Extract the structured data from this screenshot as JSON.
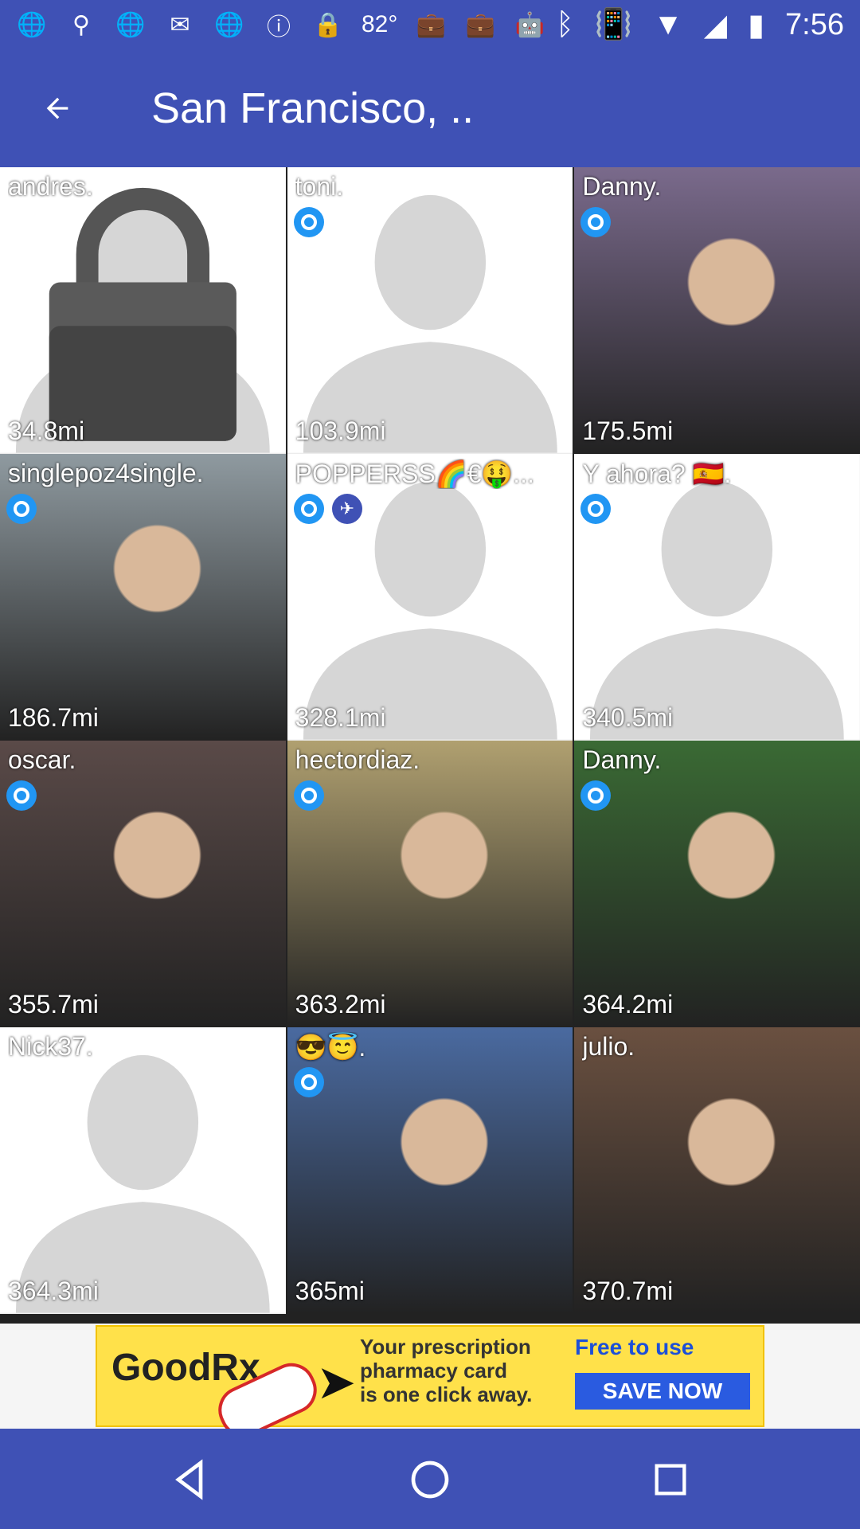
{
  "status": {
    "time": "7:56",
    "temperature": "82°",
    "icons": [
      "globe-icon",
      "keyhole-icon",
      "globe-icon",
      "mail-icon",
      "globe-icon",
      "info-icon",
      "lock-icon",
      "temperature",
      "check-briefcase-icon",
      "briefcase-icon",
      "android-icon"
    ],
    "right_icons": [
      "bluetooth-icon",
      "vibrate-icon",
      "wifi-icon",
      "signal-icon",
      "battery-icon"
    ]
  },
  "appbar": {
    "title": "San Francisco, .."
  },
  "tiles": [
    {
      "name": "andres.",
      "distance": "34.8mi",
      "badges": [],
      "kind": "locked"
    },
    {
      "name": "toni.",
      "distance": "103.9mi",
      "badges": [
        "target"
      ],
      "kind": "silhouette"
    },
    {
      "name": "Danny.",
      "distance": "175.5mi",
      "badges": [
        "target"
      ],
      "kind": "photo",
      "color": "#7a6a8c"
    },
    {
      "name": "singlepoz4single.",
      "distance": "186.7mi",
      "badges": [
        "target"
      ],
      "kind": "photo",
      "color": "#8f9aa0"
    },
    {
      "name": "POPPERSS🌈€🤑...",
      "distance": "328.1mi",
      "badges": [
        "target",
        "plane"
      ],
      "kind": "silhouette"
    },
    {
      "name": "Y ahora? 🇪🇸.",
      "distance": "340.5mi",
      "badges": [
        "target"
      ],
      "kind": "silhouette"
    },
    {
      "name": "oscar.",
      "distance": "355.7mi",
      "badges": [
        "target"
      ],
      "kind": "photo",
      "color": "#5a4a48"
    },
    {
      "name": "hectordiaz.",
      "distance": "363.2mi",
      "badges": [
        "target"
      ],
      "kind": "photo",
      "color": "#b0a070"
    },
    {
      "name": "Danny.",
      "distance": "364.2mi",
      "badges": [
        "target"
      ],
      "kind": "photo",
      "color": "#3a6a34"
    },
    {
      "name": "Nick37.",
      "distance": "364.3mi",
      "badges": [],
      "kind": "silhouette"
    },
    {
      "name": "😎😇.",
      "distance": "365mi",
      "badges": [
        "target"
      ],
      "kind": "photo",
      "color": "#4a6aa0"
    },
    {
      "name": "julio.",
      "distance": "370.7mi",
      "badges": [],
      "kind": "photo",
      "color": "#6a5040"
    }
  ],
  "ad": {
    "brand": "GoodRx",
    "line1": "Your prescription",
    "line2": "pharmacy card",
    "line3": "is one click away.",
    "free": "Free to use",
    "cta": "SAVE NOW",
    "accent": "#ffe14a"
  },
  "colors": {
    "primary": "#3f51b5",
    "badge": "#2196f3"
  }
}
